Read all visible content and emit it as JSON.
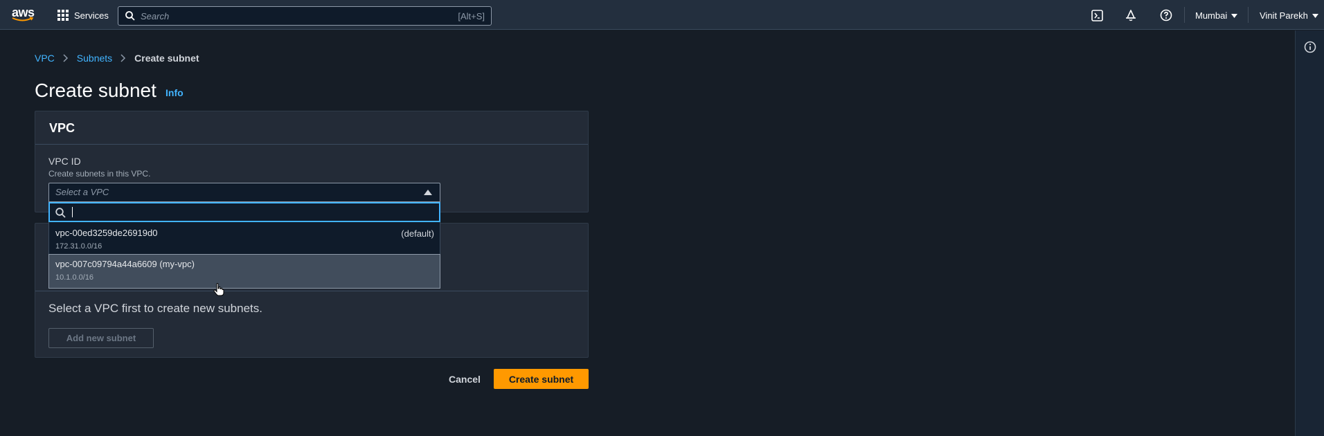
{
  "topnav": {
    "logo_text": "aws",
    "services_label": "Services",
    "search_placeholder": "Search",
    "search_shortcut": "[Alt+S]",
    "region": "Mumbai",
    "user": "Vinit Parekh"
  },
  "breadcrumb": {
    "items": [
      "VPC",
      "Subnets"
    ],
    "current": "Create subnet"
  },
  "page": {
    "title": "Create subnet",
    "info_link": "Info"
  },
  "vpc_panel": {
    "heading": "VPC",
    "field_label": "VPC ID",
    "field_description": "Create subnets in this VPC.",
    "select_placeholder": "Select a VPC",
    "options": [
      {
        "name": "vpc-00ed3259de26919d0",
        "cidr": "172.31.0.0/16",
        "tag": "(default)"
      },
      {
        "name": "vpc-007c09794a44a6609 (my-vpc)",
        "cidr": "10.1.0.0/16",
        "tag": ""
      }
    ]
  },
  "subnet_panel": {
    "message": "Select a VPC first to create new subnets.",
    "add_button": "Add new subnet"
  },
  "actions": {
    "cancel": "Cancel",
    "create": "Create subnet"
  },
  "colors": {
    "accent_link": "#42b4ff",
    "primary_button": "#ff9900",
    "background": "#161d26"
  }
}
